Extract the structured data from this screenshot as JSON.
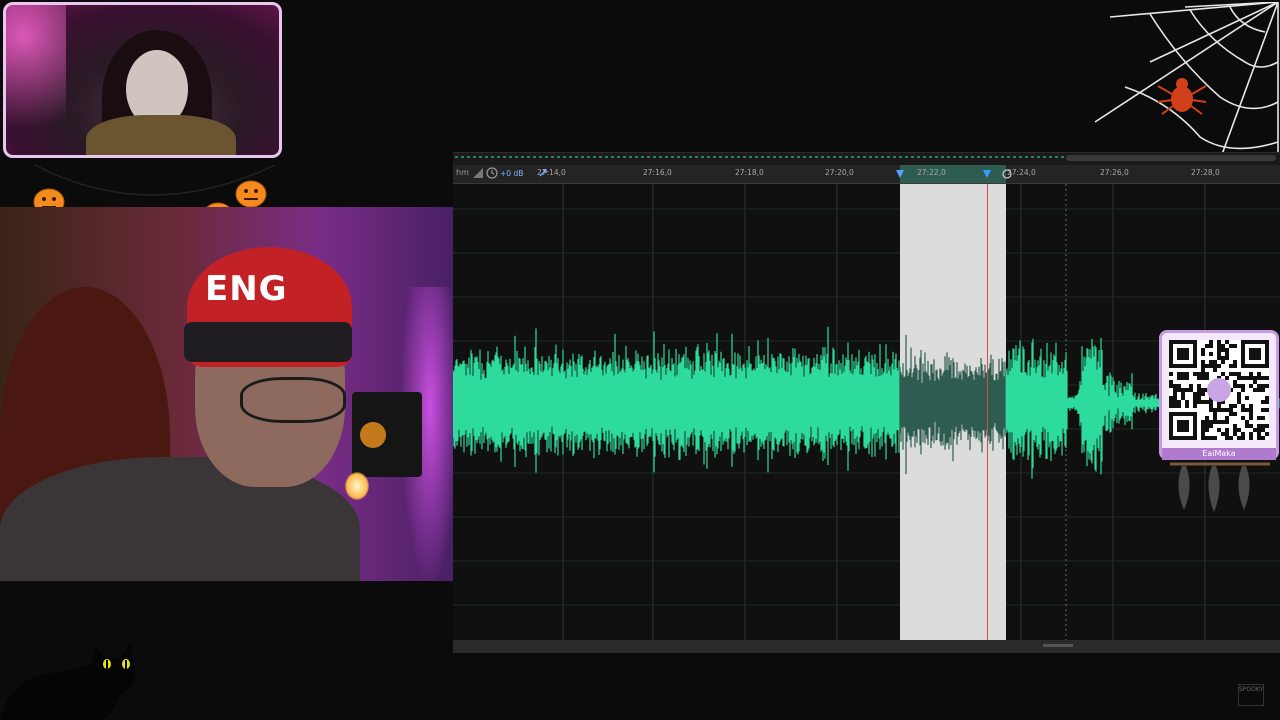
{
  "editor": {
    "ruler_left_label": "hm",
    "volume_label": "+0 dB",
    "time_ticks": [
      {
        "label": "27:14,0"
      },
      {
        "label": "27:16,0"
      },
      {
        "label": "27:18,0"
      },
      {
        "label": "27:20,0"
      },
      {
        "label": "27:22,0"
      },
      {
        "label": "27:24,0"
      },
      {
        "label": "27:26,0"
      },
      {
        "label": "27:28,0"
      }
    ],
    "colors": {
      "waveform": "#2ddc9c",
      "waveform_selected": "#2e5c50",
      "selection_bg": "#dcdcdc",
      "playhead": "#d94a4a",
      "background": "#101010"
    }
  },
  "overlay": {
    "qr_label": "EaiMaka",
    "corner_logo": "SPOOKY"
  },
  "webcam": {
    "beanie_text": "ENG"
  }
}
